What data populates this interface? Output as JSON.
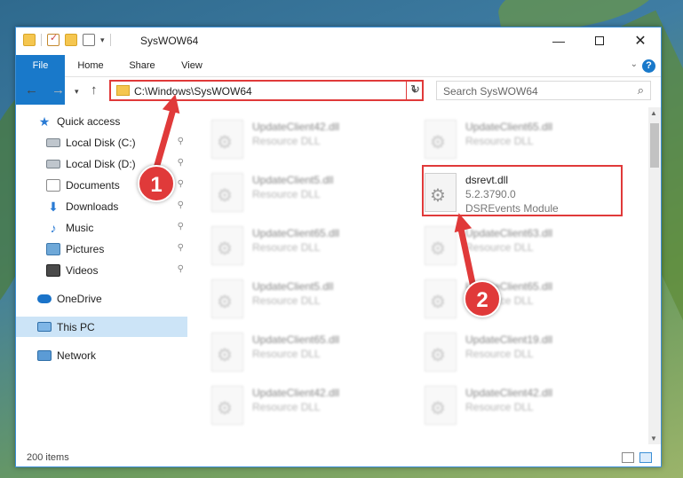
{
  "window": {
    "title": "SysWOW64",
    "min_glyph": "—",
    "close_glyph": "✕"
  },
  "ribbon": {
    "tabs": [
      "File",
      "Home",
      "Share",
      "View"
    ],
    "help": "?"
  },
  "nav": {
    "back": "←",
    "forward": "→",
    "recent": "▾",
    "up": "↑",
    "address": "C:\\Windows\\SysWOW64",
    "refresh": "↻",
    "search_placeholder": "Search SysWOW64",
    "search_icon": "⌕"
  },
  "sidebar": {
    "items": [
      {
        "label": "Quick access",
        "icon": "star-icon",
        "pinned": false
      },
      {
        "label": "Local Disk (C:)",
        "icon": "disk-icon",
        "pinned": true
      },
      {
        "label": "Local Disk (D:)",
        "icon": "disk-icon",
        "pinned": true
      },
      {
        "label": "Documents",
        "icon": "document-icon",
        "pinned": true
      },
      {
        "label": "Downloads",
        "icon": "download-icon",
        "pinned": true
      },
      {
        "label": "Music",
        "icon": "music-icon",
        "pinned": true
      },
      {
        "label": "Pictures",
        "icon": "pictures-icon",
        "pinned": true
      },
      {
        "label": "Videos",
        "icon": "video-icon",
        "pinned": true
      },
      {
        "label": "OneDrive",
        "icon": "cloud-icon",
        "pinned": false
      },
      {
        "label": "This PC",
        "icon": "computer-icon",
        "pinned": false,
        "selected": true
      },
      {
        "label": "Network",
        "icon": "network-icon",
        "pinned": false
      }
    ],
    "pin_glyph": "📌"
  },
  "files": {
    "left": [
      {
        "name": "UpdateClient42.dll",
        "desc": "Resource DLL"
      },
      {
        "name": "UpdateClient5.dll",
        "desc": "Resource DLL"
      },
      {
        "name": "UpdateClient65.dll",
        "desc": "Resource DLL"
      },
      {
        "name": "UpdateClient5.dll",
        "desc": "Resource DLL"
      },
      {
        "name": "UpdateClient65.dll",
        "desc": "Resource DLL"
      },
      {
        "name": "UpdateClient42.dll",
        "desc": "Resource DLL"
      }
    ],
    "right": [
      {
        "name": "UpdateClient65.dll",
        "desc": "Resource DLL"
      },
      {
        "name": "dsrevt.dll",
        "desc": "5.2.3790.0",
        "sub": "DSREvents Module"
      },
      {
        "name": "UpdateClient63.dll",
        "desc": "Resource DLL"
      },
      {
        "name": "UpdateClient65.dll",
        "desc": "Resource DLL"
      },
      {
        "name": "UpdateClient19.dll",
        "desc": "Resource DLL"
      },
      {
        "name": "UpdateClient42.dll",
        "desc": "Resource DLL"
      }
    ]
  },
  "status": {
    "count": "200 items"
  },
  "annotations": {
    "step1": "1",
    "step2": "2",
    "color": "#e03a3a"
  }
}
